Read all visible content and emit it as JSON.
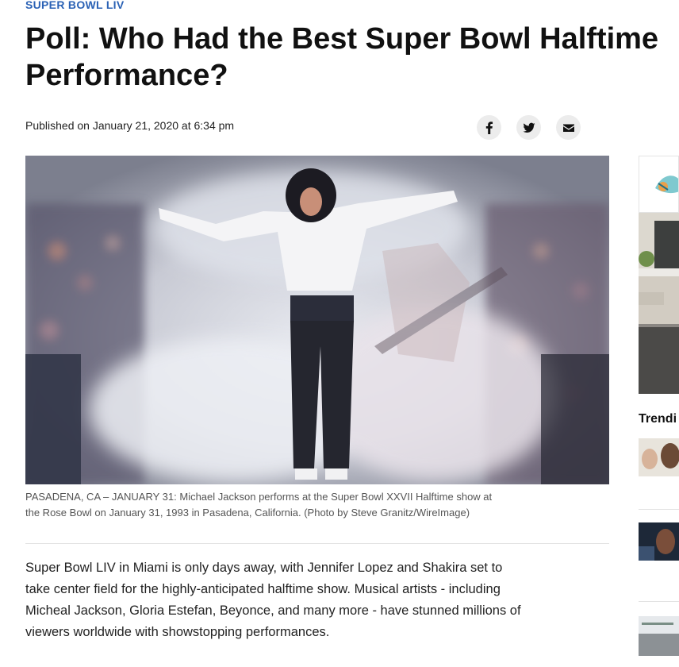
{
  "article": {
    "kicker": "SUPER BOWL LIV",
    "title_lines": [
      "Poll: Who Had the Best Super Bowl Halftime",
      "Performance?"
    ],
    "published": "Published on January 21, 2020 at 6:34 pm",
    "caption_lines": [
      "PASADENA, CA – JANUARY 31: Michael Jackson performs at the Super Bowl XXVII Halftime show at",
      "the Rose Bowl on January 31, 1993 in Pasadena, California. (Photo by Steve Granitz/WireImage)"
    ],
    "body_lines": [
      "Super Bowl LIV in Miami is only days away, with Jennifer Lopez and Shakira set to",
      "take center field for the highly-anticipated halftime show. Musical artists - including",
      "Micheal Jackson, Gloria Estefan, Beyonce, and many more - have stunned millions of",
      "viewers worldwide with showstopping performances."
    ]
  },
  "share": {
    "icons": [
      "facebook-icon",
      "twitter-icon",
      "email-icon"
    ]
  },
  "sidebar": {
    "trending_label": "Trendi"
  },
  "colors": {
    "kicker": "#2b62b5",
    "share_bg": "#ececec",
    "divider": "#e3e3e3"
  }
}
